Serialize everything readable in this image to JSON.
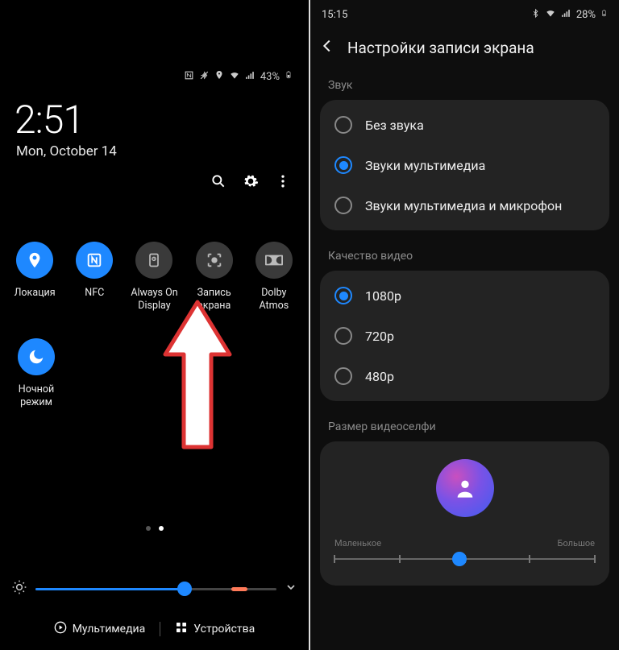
{
  "left": {
    "status": {
      "battery": "43%"
    },
    "time": "2:51",
    "date": "Mon, October 14",
    "tiles": [
      {
        "label": "Локация",
        "on": true,
        "icon": "location"
      },
      {
        "label": "NFC",
        "on": true,
        "icon": "nfc"
      },
      {
        "label": "Always On Display",
        "on": false,
        "icon": "aod"
      },
      {
        "label": "Запись экрана",
        "on": false,
        "icon": "screenrec"
      },
      {
        "label": "Dolby Atmos",
        "on": false,
        "icon": "dolby"
      },
      {
        "label": "Ночной режим",
        "on": true,
        "icon": "moon"
      }
    ],
    "brightness_percent": 62,
    "bottom": {
      "multimedia": "Мультимедиа",
      "devices": "Устройства"
    },
    "pages": {
      "total": 2,
      "current": 2
    }
  },
  "right": {
    "status": {
      "time": "15:15",
      "battery": "28%"
    },
    "title": "Настройки записи экрана",
    "sections": {
      "sound": {
        "label": "Звук",
        "options": [
          "Без звука",
          "Звуки мультимедиа",
          "Звуки мультимедиа и микрофон"
        ],
        "selected": 1
      },
      "quality": {
        "label": "Качество видео",
        "options": [
          "1080p",
          "720p",
          "480p"
        ],
        "selected": 0
      },
      "selfie": {
        "label": "Размер видеоселфи",
        "min_label": "Маленькое",
        "max_label": "Большое",
        "value_percent": 48
      }
    }
  },
  "colors": {
    "accent": "#1e88ff"
  }
}
